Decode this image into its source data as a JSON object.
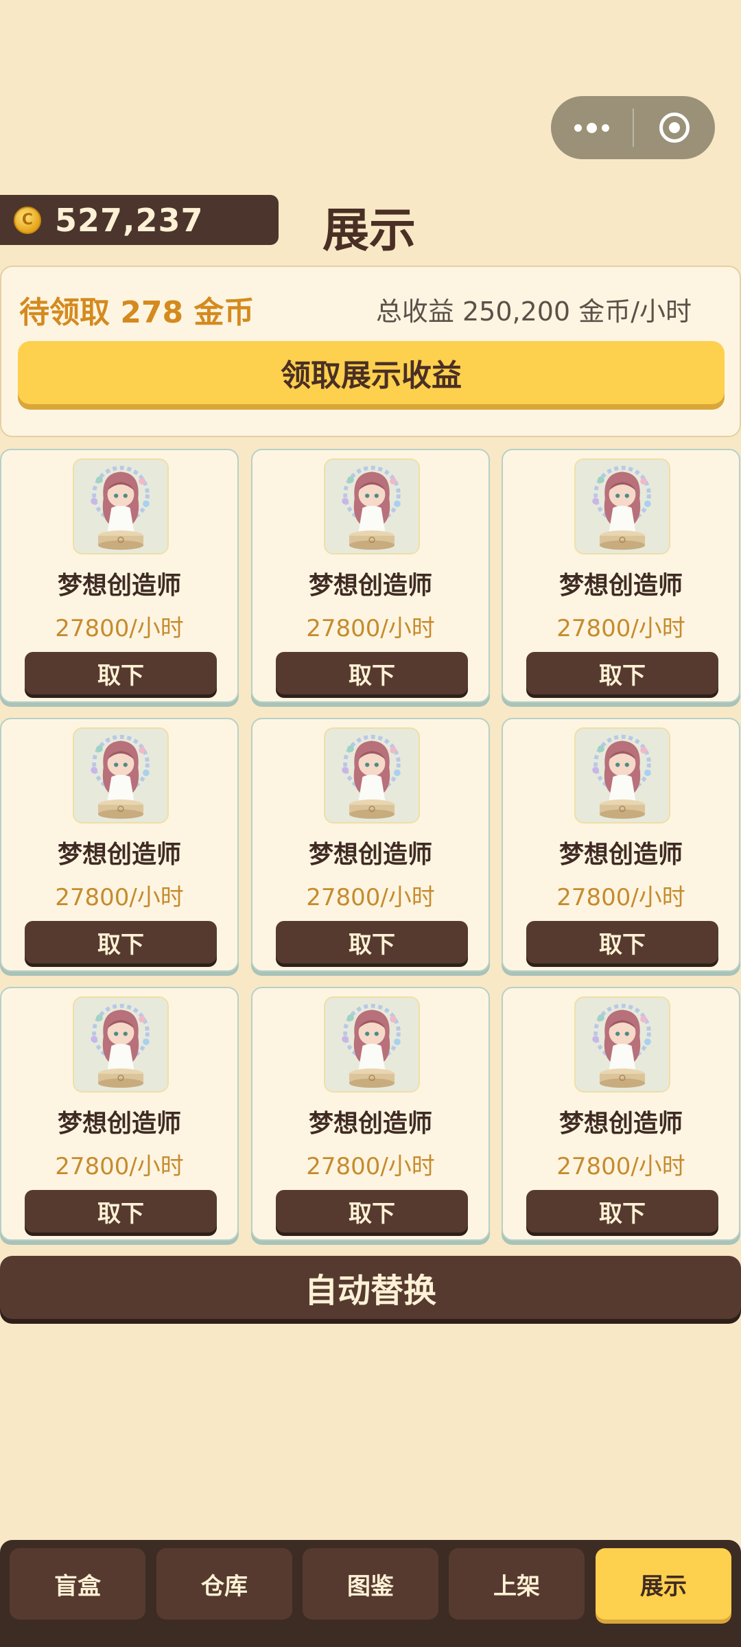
{
  "header": {
    "coins": "527,237",
    "coin_icon_letter": "C",
    "title": "展示"
  },
  "income": {
    "pending": "待领取 278 金币",
    "total": "总收益 250,200 金币/小时",
    "claim_label": "领取展示收益"
  },
  "slots": [
    {
      "name": "梦想创造师",
      "rate": "27800/小时",
      "button": "取下"
    },
    {
      "name": "梦想创造师",
      "rate": "27800/小时",
      "button": "取下"
    },
    {
      "name": "梦想创造师",
      "rate": "27800/小时",
      "button": "取下"
    },
    {
      "name": "梦想创造师",
      "rate": "27800/小时",
      "button": "取下"
    },
    {
      "name": "梦想创造师",
      "rate": "27800/小时",
      "button": "取下"
    },
    {
      "name": "梦想创造师",
      "rate": "27800/小时",
      "button": "取下"
    },
    {
      "name": "梦想创造师",
      "rate": "27800/小时",
      "button": "取下"
    },
    {
      "name": "梦想创造师",
      "rate": "27800/小时",
      "button": "取下"
    },
    {
      "name": "梦想创造师",
      "rate": "27800/小时",
      "button": "取下"
    }
  ],
  "auto_replace_label": "自动替换",
  "nav": {
    "tabs": [
      "盲盒",
      "仓库",
      "图鉴",
      "上架",
      "展示"
    ],
    "active": "展示"
  },
  "colors": {
    "background": "#f8e8c6",
    "accent": "#fdd04e",
    "dark": "#563a2f",
    "pending_text": "#d48a1e"
  }
}
